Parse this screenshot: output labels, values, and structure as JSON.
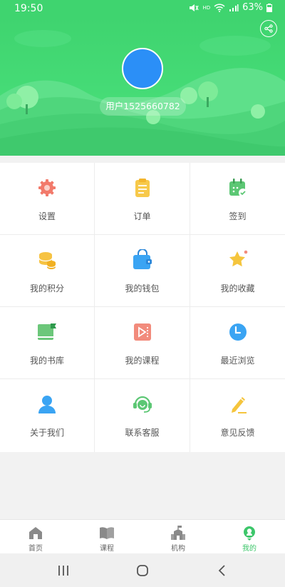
{
  "status": {
    "time": "19:50",
    "hd": "HD",
    "battery": "63%"
  },
  "header": {
    "username": "用户1525660782"
  },
  "menu": [
    {
      "label": "设置",
      "icon": "gear-icon",
      "color": "#f27a6b"
    },
    {
      "label": "订单",
      "icon": "clipboard-icon",
      "color": "#f7c94a"
    },
    {
      "label": "签到",
      "icon": "calendar-check-icon",
      "color": "#5cc774"
    },
    {
      "label": "我的积分",
      "icon": "coins-icon",
      "color": "#f6c343"
    },
    {
      "label": "我的钱包",
      "icon": "wallet-icon",
      "color": "#3aa4f3"
    },
    {
      "label": "我的收藏",
      "icon": "star-icon",
      "color": "#f5c53d"
    },
    {
      "label": "我的书库",
      "icon": "bookshelf-icon",
      "color": "#6cc77a"
    },
    {
      "label": "我的课程",
      "icon": "video-icon",
      "color": "#f28b7c"
    },
    {
      "label": "最近浏览",
      "icon": "clock-icon",
      "color": "#3aa4f3"
    },
    {
      "label": "关于我们",
      "icon": "person-icon",
      "color": "#3aa4f3"
    },
    {
      "label": "联系客服",
      "icon": "headset-icon",
      "color": "#5cc774"
    },
    {
      "label": "意见反馈",
      "icon": "pencil-icon",
      "color": "#f5c53d"
    }
  ],
  "nav": [
    {
      "label": "首页",
      "icon": "home-icon"
    },
    {
      "label": "课程",
      "icon": "book-icon"
    },
    {
      "label": "机构",
      "icon": "building-icon"
    },
    {
      "label": "我的",
      "icon": "profile-icon",
      "active": true
    }
  ],
  "colors": {
    "primary": "#3fd46f",
    "nav_active": "#3cc66a"
  }
}
